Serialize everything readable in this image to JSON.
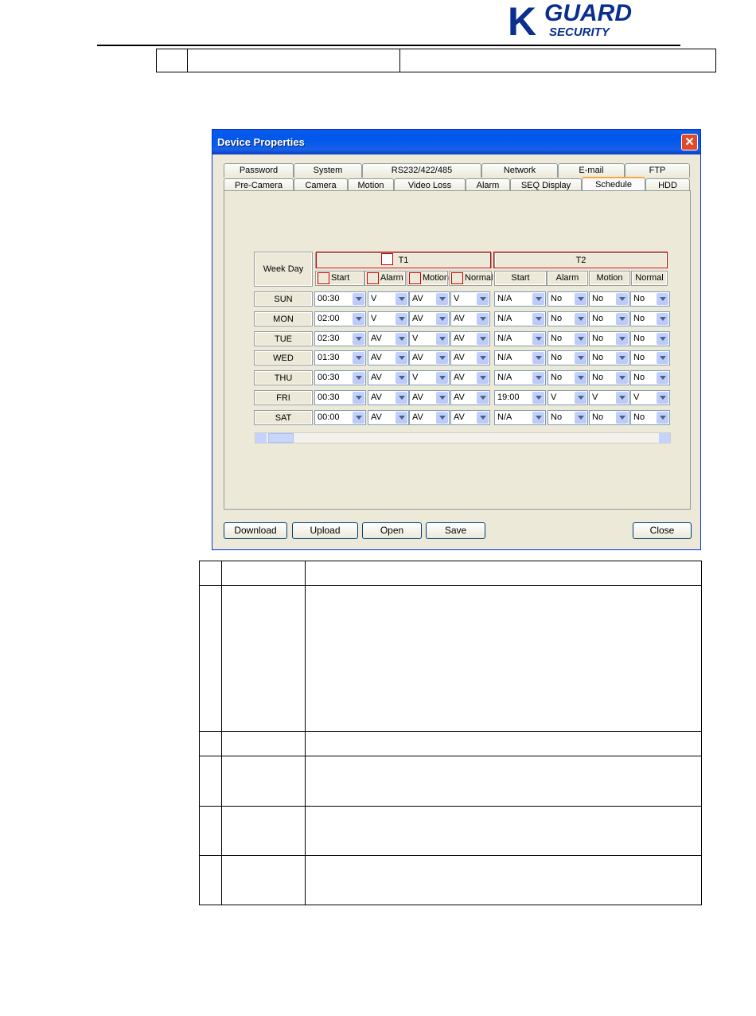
{
  "logo": {
    "big_letter": "K",
    "word1": "GUARD",
    "word2": "SECURITY"
  },
  "dialog": {
    "title": "Device Properties",
    "close_glyph": "✕",
    "tabs_row1": [
      "Password",
      "System",
      "RS232/422/485",
      "Network",
      "E-mail",
      "FTP"
    ],
    "tabs_row2": [
      "Pre-Camera",
      "Camera",
      "Motion",
      "Video Loss",
      "Alarm",
      "SEQ Display",
      "Schedule",
      "HDD"
    ],
    "active_tab": "Schedule",
    "schedule": {
      "weekday_header": "Week Day",
      "t1_label": "T1",
      "t2_label": "T2",
      "t1_columns": [
        "Start",
        "Alarm",
        "Motion",
        "Normal"
      ],
      "t2_columns": [
        "Start",
        "Alarm",
        "Motion",
        "Normal"
      ],
      "rows": [
        {
          "day": "SUN",
          "t1": [
            "00:30",
            "V",
            "AV",
            "V"
          ],
          "t2": [
            "N/A",
            "No",
            "No",
            "No"
          ]
        },
        {
          "day": "MON",
          "t1": [
            "02:00",
            "V",
            "AV",
            "AV"
          ],
          "t2": [
            "N/A",
            "No",
            "No",
            "No"
          ]
        },
        {
          "day": "TUE",
          "t1": [
            "02:30",
            "AV",
            "V",
            "AV"
          ],
          "t2": [
            "N/A",
            "No",
            "No",
            "No"
          ]
        },
        {
          "day": "WED",
          "t1": [
            "01:30",
            "AV",
            "AV",
            "AV"
          ],
          "t2": [
            "N/A",
            "No",
            "No",
            "No"
          ]
        },
        {
          "day": "THU",
          "t1": [
            "00:30",
            "AV",
            "V",
            "AV"
          ],
          "t2": [
            "N/A",
            "No",
            "No",
            "No"
          ]
        },
        {
          "day": "FRI",
          "t1": [
            "00:30",
            "AV",
            "AV",
            "AV"
          ],
          "t2": [
            "19:00",
            "V",
            "V",
            "V"
          ]
        },
        {
          "day": "SAT",
          "t1": [
            "00:00",
            "AV",
            "AV",
            "AV"
          ],
          "t2": [
            "N/A",
            "No",
            "No",
            "No"
          ]
        }
      ]
    },
    "buttons": {
      "download": "Download",
      "upload": "Upload",
      "open": "Open",
      "save": "Save",
      "close": "Close"
    }
  },
  "colors": {
    "titlebar": "#0058ee",
    "annotation_red": "#cc0000",
    "dialog_bg": "#ece9d8"
  }
}
